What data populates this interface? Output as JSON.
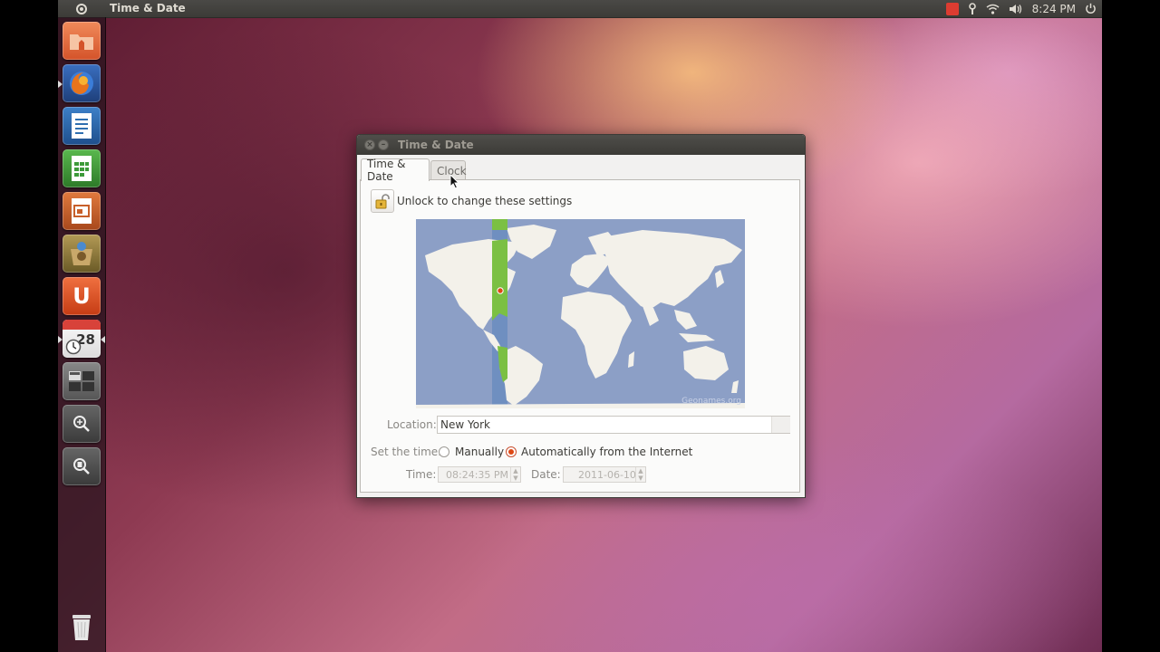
{
  "top_panel": {
    "title": "Time & Date",
    "clock": "8:24 PM"
  },
  "launcher": {
    "items": [
      {
        "name": "home-folder",
        "color": "#e8663a"
      },
      {
        "name": "firefox",
        "color": "#2b5aa8"
      },
      {
        "name": "libreoffice-writer",
        "color": "#2f6fb0"
      },
      {
        "name": "libreoffice-calc",
        "color": "#3d9a3a"
      },
      {
        "name": "libreoffice-impress",
        "color": "#c8602b"
      },
      {
        "name": "software-center",
        "color": "#8a7a3a"
      },
      {
        "name": "ubuntu-one",
        "color": "#e0542c",
        "glyph": "U"
      },
      {
        "name": "time-and-date",
        "color": "#c8413f",
        "glyph": "28"
      },
      {
        "name": "workspace-switcher",
        "color": "#6b6b6b"
      },
      {
        "name": "applications-lens",
        "color": "#555555"
      },
      {
        "name": "files-lens",
        "color": "#555555"
      },
      {
        "name": "trash",
        "color": "#4a4a4a"
      }
    ]
  },
  "dialog": {
    "title": "Time & Date",
    "tabs": [
      {
        "label": "Time & Date",
        "active": true
      },
      {
        "label": "Clock",
        "active": false
      }
    ],
    "unlock_label": "Unlock to change these settings",
    "map_credit": "Geonames.org",
    "location_label": "Location:",
    "location_value": "New York",
    "set_time_label": "Set the time:",
    "radio_manual": "Manually",
    "radio_auto": "Automatically from the Internet",
    "selected_mode": "auto",
    "time_label": "Time:",
    "time_value": "08:24:35 PM",
    "date_label": "Date:",
    "date_value": "2011-06-10"
  },
  "colors": {
    "accent": "#dd4814",
    "panel": "#3c3b37",
    "map_sea": "#8c9fc6",
    "map_land": "#f3f1ea",
    "timezone_band": "#7bc043"
  }
}
